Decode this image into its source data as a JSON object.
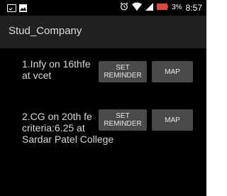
{
  "status_bar": {
    "left_icons": [
      "notification-icon",
      "image-icon"
    ],
    "right_icons": [
      "alarm-icon",
      "wifi-icon",
      "signal-icon",
      "battery-icon"
    ],
    "battery_percent": "3%",
    "time": "8:57"
  },
  "app_bar": {
    "title": "Stud_Company"
  },
  "companies": [
    {
      "text_lines": [
        "1.Infy on 16thfe",
        "at vcet"
      ],
      "reminder_label": "SET REMINDER",
      "map_label": "MAP"
    },
    {
      "text_lines": [
        "2.CG on 20th fe",
        "criteria:6.25 at",
        "Sardar Patel College"
      ],
      "reminder_label": "SET REMINDER",
      "map_label": "MAP"
    }
  ],
  "colors": {
    "background": "#000000",
    "app_bar": "#202020",
    "button": "#4a4a4a",
    "battery": "#e0463a"
  }
}
